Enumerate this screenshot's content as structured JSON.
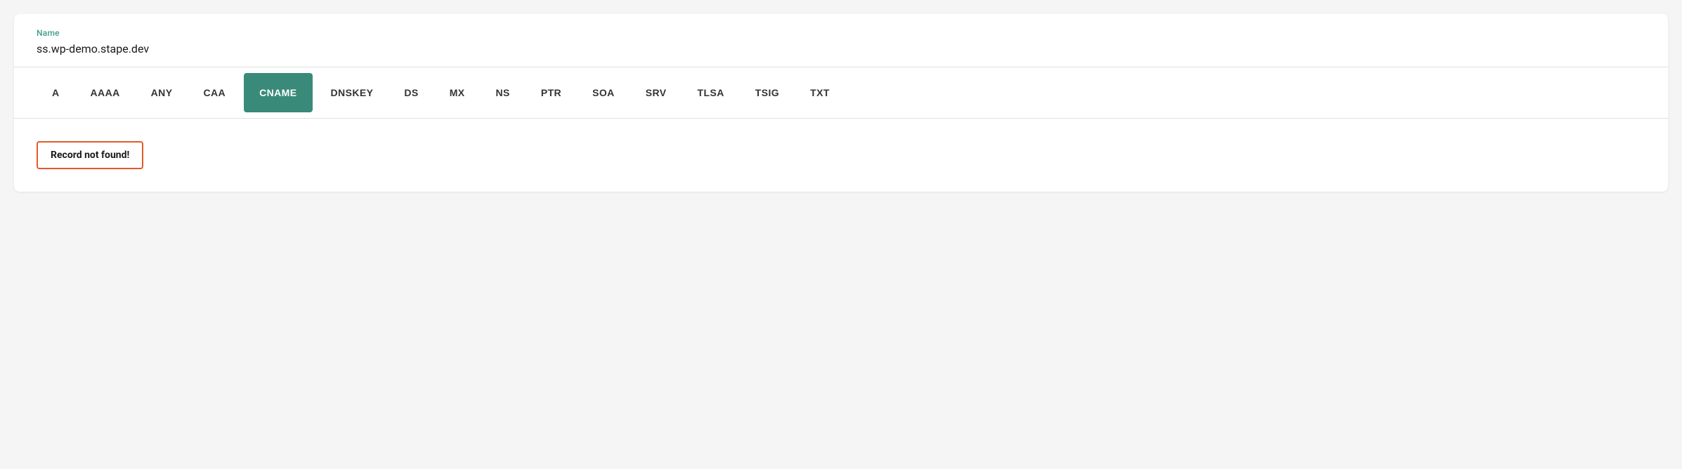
{
  "header": {
    "name_label": "Name",
    "name_value": "ss.wp-demo.stape.dev"
  },
  "tabs": {
    "items": [
      {
        "id": "A",
        "label": "A",
        "active": false
      },
      {
        "id": "AAAA",
        "label": "AAAA",
        "active": false
      },
      {
        "id": "ANY",
        "label": "ANY",
        "active": false
      },
      {
        "id": "CAA",
        "label": "CAA",
        "active": false
      },
      {
        "id": "CNAME",
        "label": "CNAME",
        "active": true
      },
      {
        "id": "DNSKEY",
        "label": "DNSKEY",
        "active": false
      },
      {
        "id": "DS",
        "label": "DS",
        "active": false
      },
      {
        "id": "MX",
        "label": "MX",
        "active": false
      },
      {
        "id": "NS",
        "label": "NS",
        "active": false
      },
      {
        "id": "PTR",
        "label": "PTR",
        "active": false
      },
      {
        "id": "SOA",
        "label": "SOA",
        "active": false
      },
      {
        "id": "SRV",
        "label": "SRV",
        "active": false
      },
      {
        "id": "TLSA",
        "label": "TLSA",
        "active": false
      },
      {
        "id": "TSIG",
        "label": "TSIG",
        "active": false
      },
      {
        "id": "TXT",
        "label": "TXT",
        "active": false
      }
    ]
  },
  "content": {
    "record_not_found_text": "Record not found!"
  },
  "colors": {
    "active_tab_bg": "#3a8a7a",
    "label_color": "#3a9e8a",
    "border_color": "#e05a2b"
  }
}
